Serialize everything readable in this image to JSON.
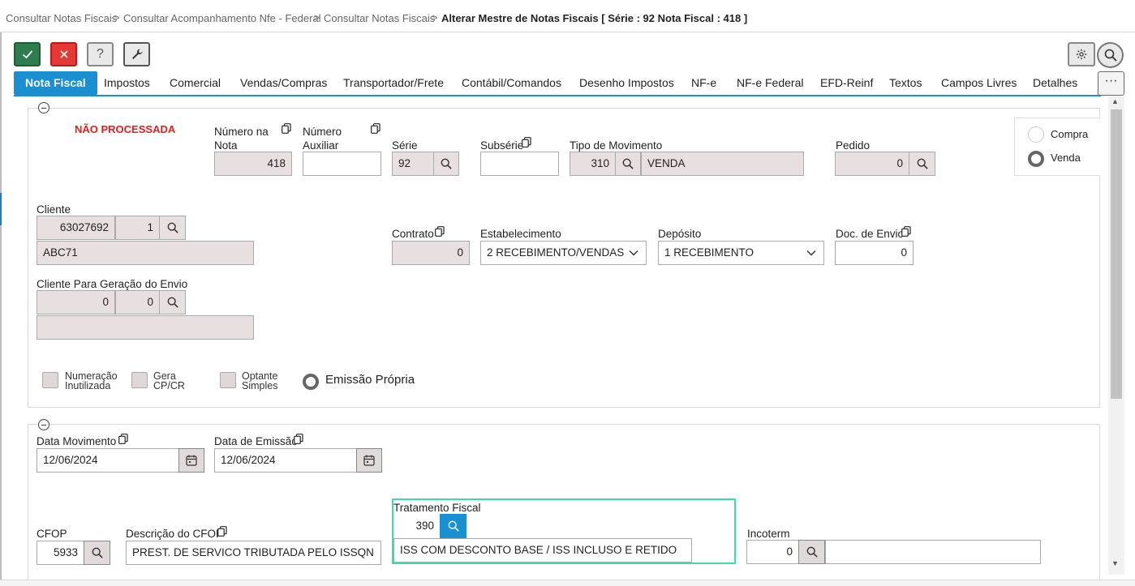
{
  "breadcrumb": {
    "items": [
      "Consultar Notas Fiscais",
      "Consultar Acompanhamento Nfe - Federal",
      "Consultar Notas Fiscais"
    ],
    "current": "Alterar Mestre de Notas Fiscais [ Série : 92 Nota Fiscal : 418 ]",
    "separator": ">"
  },
  "toolbar": {
    "confirm_icon": "check-icon",
    "cancel_icon": "close-icon",
    "help_label": "?",
    "tools_icon": "wrench-icon",
    "settings_icon": "gear-icon",
    "search_icon": "search-icon"
  },
  "tabs": [
    {
      "label": "Nota Fiscal",
      "active": true
    },
    {
      "label": "Impostos"
    },
    {
      "label": "Comercial"
    },
    {
      "label": "Vendas/Compras"
    },
    {
      "label": "Transportador/Frete"
    },
    {
      "label": "Contábil/Comandos"
    },
    {
      "label": "Desenho Impostos"
    },
    {
      "label": "NF-e"
    },
    {
      "label": "NF-e Federal"
    },
    {
      "label": "EFD-Reinf"
    },
    {
      "label": "Textos"
    },
    {
      "label": "Campos Livres"
    },
    {
      "label": "Detalhes"
    }
  ],
  "tabs_more_label": "···",
  "header": {
    "status": "NÃO PROCESSADA",
    "numero_nota": {
      "label1": "Número na",
      "label2": "Nota",
      "value": "418"
    },
    "numero_auxiliar": {
      "label1": "Número",
      "label2": "Auxiliar",
      "value": ""
    },
    "serie": {
      "label": "Série",
      "value": "92"
    },
    "subserie": {
      "label": "Subsérie",
      "value": ""
    },
    "tipo_movimento": {
      "label": "Tipo de Movimento",
      "code": "310",
      "description": "VENDA"
    },
    "pedido": {
      "label": "Pedido",
      "value": "0"
    },
    "operacao": {
      "options": [
        "Compra",
        "Venda"
      ],
      "selected": "Venda"
    },
    "cliente": {
      "label": "Cliente",
      "code": "63027692",
      "seq": "1",
      "name": "ABC71"
    },
    "contrato": {
      "label": "Contrato",
      "value": "0"
    },
    "estabelecimento": {
      "label": "Estabelecimento",
      "value": "2 RECEBIMENTO/VENDAS"
    },
    "deposito": {
      "label": "Depósito",
      "value": "1 RECEBIMENTO"
    },
    "doc_envio": {
      "label": "Doc. de Envio",
      "value": "0"
    },
    "cliente_envio": {
      "label": "Cliente Para Geração do Envio",
      "code": "0",
      "seq": "0",
      "name": ""
    },
    "checks": [
      {
        "line1": "Numeração",
        "line2": "Inutilizada"
      },
      {
        "line1": "Gera",
        "line2": "CP/CR"
      },
      {
        "line1": "Optante",
        "line2": "Simples"
      }
    ],
    "emissao_propria": "Emissão Própria"
  },
  "datas": {
    "data_movimento": {
      "label": "Data Movimento",
      "value": "12/06/2024"
    },
    "data_emissao": {
      "label": "Data de Emissão",
      "value": "12/06/2024"
    },
    "cfop": {
      "label": "CFOP",
      "value": "5933"
    },
    "descricao_cfop": {
      "label": "Descrição do CFOP",
      "value": "PREST. DE SERVICO TRIBUTADA PELO ISSQN"
    },
    "tratamento_fiscal": {
      "label": "Tratamento Fiscal",
      "code": "390",
      "description": "ISS COM DESCONTO BASE / ISS INCLUSO E RETIDO"
    },
    "incoterm": {
      "label": "Incoterm",
      "code": "0",
      "description": ""
    }
  },
  "colors": {
    "accent": "#1a8fd1",
    "ok": "#2e7d4f",
    "cancel": "#e53935",
    "status": "#e02020",
    "focus": "#3fdaa6"
  }
}
